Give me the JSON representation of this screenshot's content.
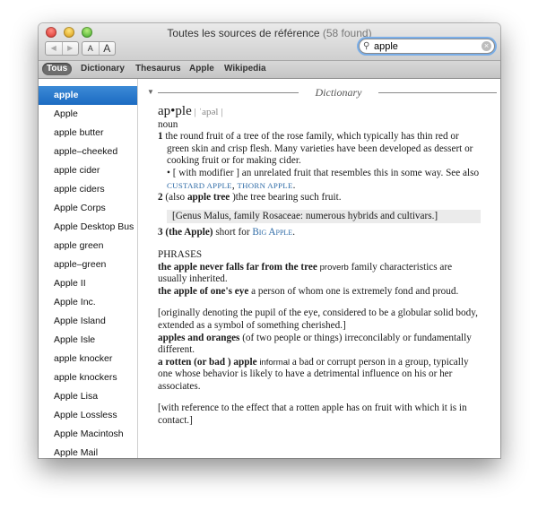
{
  "window": {
    "title": "Toutes les sources de référence",
    "count": "(58 found)"
  },
  "toolbar": {
    "back": "◀",
    "forward": "▶",
    "font_smaller": "A",
    "font_larger": "A",
    "search_value": "apple",
    "search_icon": "magnifier-icon",
    "clear_icon": "×"
  },
  "scopes": [
    "Tous",
    "Dictionary",
    "Thesaurus",
    "Apple",
    "Wikipedia"
  ],
  "sidebar": {
    "items": [
      "apple",
      "Apple",
      "apple butter",
      "apple–cheeked",
      "apple cider",
      "apple ciders",
      "Apple Corps",
      "Apple Desktop Bus",
      "apple green",
      "apple–green",
      "Apple II",
      "Apple Inc.",
      "Apple Island",
      "Apple Isle",
      "apple knocker",
      "apple knockers",
      "Apple Lisa",
      "Apple Lossless",
      "Apple Macintosh",
      "Apple Mail"
    ]
  },
  "content": {
    "section_label": "Dictionary",
    "headword": "ap•ple",
    "pronunciation": "| ˈapəl |",
    "pos": "noun",
    "s1_num": "1",
    "s1_text": "the round fruit of a tree of the rose family, which typically has thin red or green skin and crisp flesh. Many varieties have been developed as dessert or cooking fruit or for making cider.",
    "s1_mod_pre": "• [ with modifier ]",
    "s1_mod_text": "an unrelated fruit that resembles this in some way.",
    "s1_see": "See also",
    "s1_xref1": "CUSTARD APPLE",
    "s1_comma": ",",
    "s1_xref2": "THORN APPLE",
    "s1_period": ".",
    "s2_num": "2",
    "s2_pre": "(also",
    "s2_bold": "apple tree",
    "s2_text": ")the tree bearing such fruit.",
    "genus": "[Genus Malus, family Rosaceae: numerous hybrids and cultivars.]",
    "s3_num": "3",
    "s3_bold": "(the Apple)",
    "s3_text": "short for",
    "s3_link": "Big Apple",
    "s3_period": ".",
    "phrases_label": "PHRASES",
    "p1_bold": "the apple never falls far from the tree",
    "p1_tag": "proverb",
    "p1_text": "family characteristics are usually inherited.",
    "p2_bold": "the apple of one's eye",
    "p2_text": "a person of whom one is extremely fond and proud.",
    "origin": "[originally denoting the pupil of the eye, considered to be a globular solid body, extended as a symbol of something cherished.]",
    "p3_bold": "apples and oranges",
    "p3_text": "(of two people or things) irreconcilably or fundamentally different.",
    "p4_bold": "a rotten (or bad ) apple",
    "p4_tag": "informal",
    "p4_text": "a bad or corrupt person in a group, typically one whose behavior is likely to have a detrimental influence on his or her associates.",
    "p4_note": "[with reference to the effect that a rotten apple has on fruit with which it is in contact.]"
  }
}
